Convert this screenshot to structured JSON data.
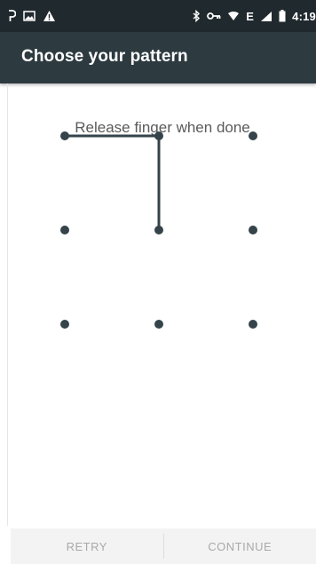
{
  "status_bar": {
    "time": "4:19",
    "network_type": "E",
    "icons_left": [
      "pinterest-icon",
      "image-icon",
      "warning-icon"
    ],
    "icons_right": [
      "bluetooth-icon",
      "vpn-key-icon",
      "wifi-icon",
      "signal-icon",
      "battery-icon"
    ]
  },
  "app_bar": {
    "title": "Choose your pattern",
    "background_color": "#2d3a40"
  },
  "pattern": {
    "header": "Release finger when done",
    "dot_color": "#35434b",
    "line_color": "#35434b",
    "grid": [
      [
        1,
        2,
        3
      ],
      [
        4,
        5,
        6
      ],
      [
        7,
        8,
        9
      ]
    ],
    "selected_sequence": [
      1,
      2,
      5
    ]
  },
  "footer": {
    "retry_label": "RETRY",
    "continue_label": "CONTINUE"
  }
}
